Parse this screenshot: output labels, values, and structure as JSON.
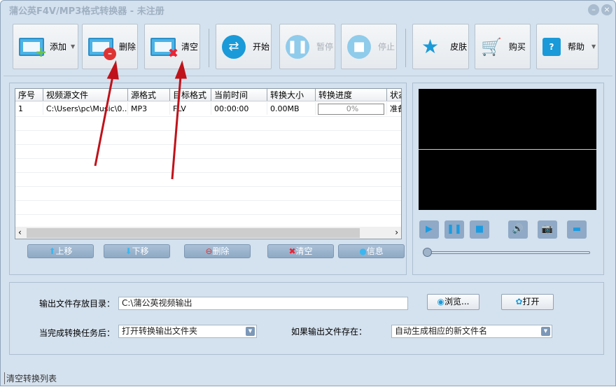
{
  "window": {
    "title": "蒲公英F4V/MP3格式转换器 - 未注册",
    "minimize_icon": "minimize-icon",
    "close_icon": "close-icon"
  },
  "toolbar": {
    "add": "添加",
    "delete": "删除",
    "clear": "清空",
    "start": "开始",
    "pause": "暂停",
    "stop": "停止",
    "skin": "皮肤",
    "buy": "购买",
    "help": "帮助"
  },
  "table": {
    "columns": [
      "序号",
      "视频源文件",
      "源格式",
      "目标格式",
      "当前时间",
      "转换大小",
      "转换进度",
      "状态"
    ],
    "rows": [
      {
        "index": "1",
        "source": "C:\\Users\\pc\\Music\\0...",
        "src_format": "MP3",
        "dst_format": "FLV",
        "time": "00:00:00",
        "size": "0.00MB",
        "progress": "0%",
        "status": "准备"
      }
    ]
  },
  "list_buttons": {
    "up": "上移",
    "down": "下移",
    "delete": "删除",
    "clear": "清空",
    "info": "信息"
  },
  "player": {
    "position": 0
  },
  "output": {
    "dir_label": "输出文件存放目录：",
    "dir_value": "C:\\蒲公英视频输出",
    "browse": "浏览...",
    "open": "打开",
    "after_label": "当完成转换任务后：",
    "after_value": "打开转换输出文件夹",
    "exists_label": "如果输出文件存在：",
    "exists_value": "自动生成相应的新文件名"
  },
  "status_bar": {
    "text": "清空转换列表"
  },
  "annotation_color": "#c0121a"
}
